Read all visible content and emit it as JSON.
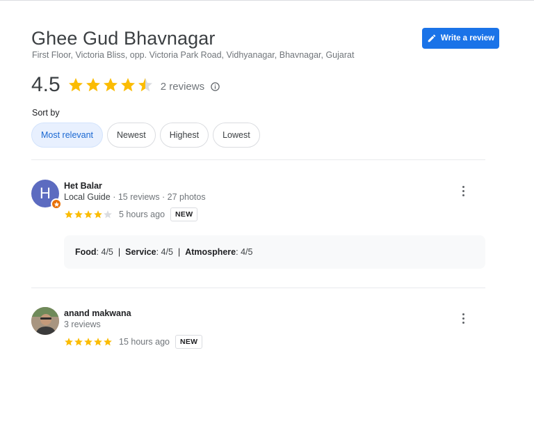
{
  "place": {
    "name": "Ghee Gud Bhavnagar",
    "address": "First Floor, Victoria Bliss, opp. Victoria Park Road, Vidhyanagar, Bhavnagar, Gujarat"
  },
  "write_review_label": "Write a review",
  "summary": {
    "rating": "4.5",
    "rating_value": 4.5,
    "review_count": "2 reviews"
  },
  "sort": {
    "label": "Sort by",
    "options": [
      "Most relevant",
      "Newest",
      "Highest",
      "Lowest"
    ],
    "selected": "Most relevant"
  },
  "reviews": [
    {
      "avatar_letter": "H",
      "name": "Het Balar",
      "local_guide": "Local Guide",
      "meta": " · 15 reviews · 27 photos",
      "stars": 4,
      "time": "5 hours ago",
      "badge": "NEW",
      "subratings": [
        {
          "label": "Food",
          "value": ": 4/5"
        },
        {
          "label": "Service",
          "value": ": 4/5"
        },
        {
          "label": "Atmosphere",
          "value": ": 4/5"
        }
      ],
      "separator": "|"
    },
    {
      "name": "anand makwana",
      "meta": "3 reviews",
      "stars": 5,
      "time": "15 hours ago",
      "badge": "NEW"
    }
  ],
  "colors": {
    "star": "#fbbc04",
    "star_empty": "#dadce0",
    "primary": "#1a73e8",
    "chip_active_bg": "#e8f0fe",
    "chip_active_text": "#1967d2",
    "avatar_bg": "#5c6bc0",
    "local_guide_badge": "#e8710a"
  },
  "icons": {
    "write": "pencil-icon",
    "info": "info-icon",
    "more": "more-vert-icon",
    "guide": "local-guide-star-icon"
  }
}
